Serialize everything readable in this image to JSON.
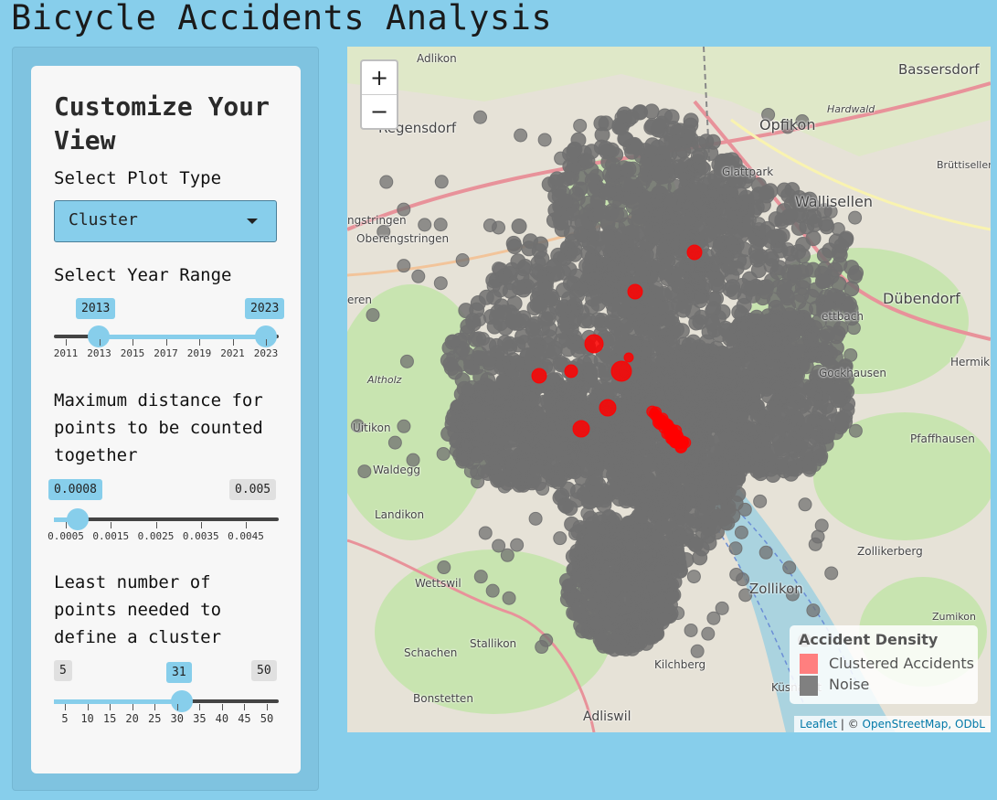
{
  "app": {
    "title": "Bicycle Accidents Analysis"
  },
  "sidebar": {
    "panel_title": "Customize Your View",
    "plot_type": {
      "label": "Select Plot Type",
      "selected": "Cluster"
    },
    "year_range": {
      "label": "Select Year Range",
      "min": 2011,
      "max": 2023,
      "low": 2013,
      "high": 2023,
      "low_label": "2013",
      "high_label": "2023",
      "ticks": [
        "2011",
        "2013",
        "2015",
        "2017",
        "2019",
        "2021",
        "2023"
      ]
    },
    "distance": {
      "label": "Maximum distance for points to be counted together",
      "min": 0.0005,
      "max": 0.005,
      "value": 0.0008,
      "value_label": "0.0008",
      "max_label": "0.005",
      "ticks": [
        "0.0005",
        "0.0015",
        "0.0025",
        "0.0035",
        "0.0045"
      ]
    },
    "min_points": {
      "label": "Least number of points needed to define a cluster",
      "min": 5,
      "max": 50,
      "value": 31,
      "min_label": "5",
      "value_label": "31",
      "max_label": "50",
      "ticks": [
        "5",
        "10",
        "15",
        "20",
        "25",
        "30",
        "35",
        "40",
        "45",
        "50"
      ]
    }
  },
  "map": {
    "zoom_in": "+",
    "zoom_out": "−",
    "places": [
      "Adlikon",
      "Bassersdorf",
      "Regensdorf",
      "Opfikon",
      "Hardwald",
      "Glattpark",
      "Wallisellen",
      "Brüttiseller",
      "Oberengstringen",
      "ngstringen",
      "Dübendorf",
      "eren",
      "Altholz",
      "Gockhausen",
      "Hermik",
      "Uitikon",
      "Pfaffhausen",
      "Waldegg",
      "Landikon",
      "Zollikerberg",
      "Wettswil",
      "Zollikon",
      "Stallikon",
      "Zumikon",
      "Schachen",
      "Kilchberg",
      "Bonstetten",
      "Küsnacht",
      "Adliswil",
      "ettbach"
    ],
    "legend": {
      "title": "Accident Density",
      "items": [
        {
          "label": "Clustered Accidents",
          "color": "#ff7f7f"
        },
        {
          "label": "Noise",
          "color": "#808080"
        }
      ]
    },
    "attribution": {
      "leaflet": "Leaflet",
      "separator": " | © ",
      "osm": "OpenStreetMap, ODbL"
    }
  },
  "colors": {
    "accent": "#87CEEB",
    "noise": "#707070",
    "cluster": "#ff0000"
  }
}
